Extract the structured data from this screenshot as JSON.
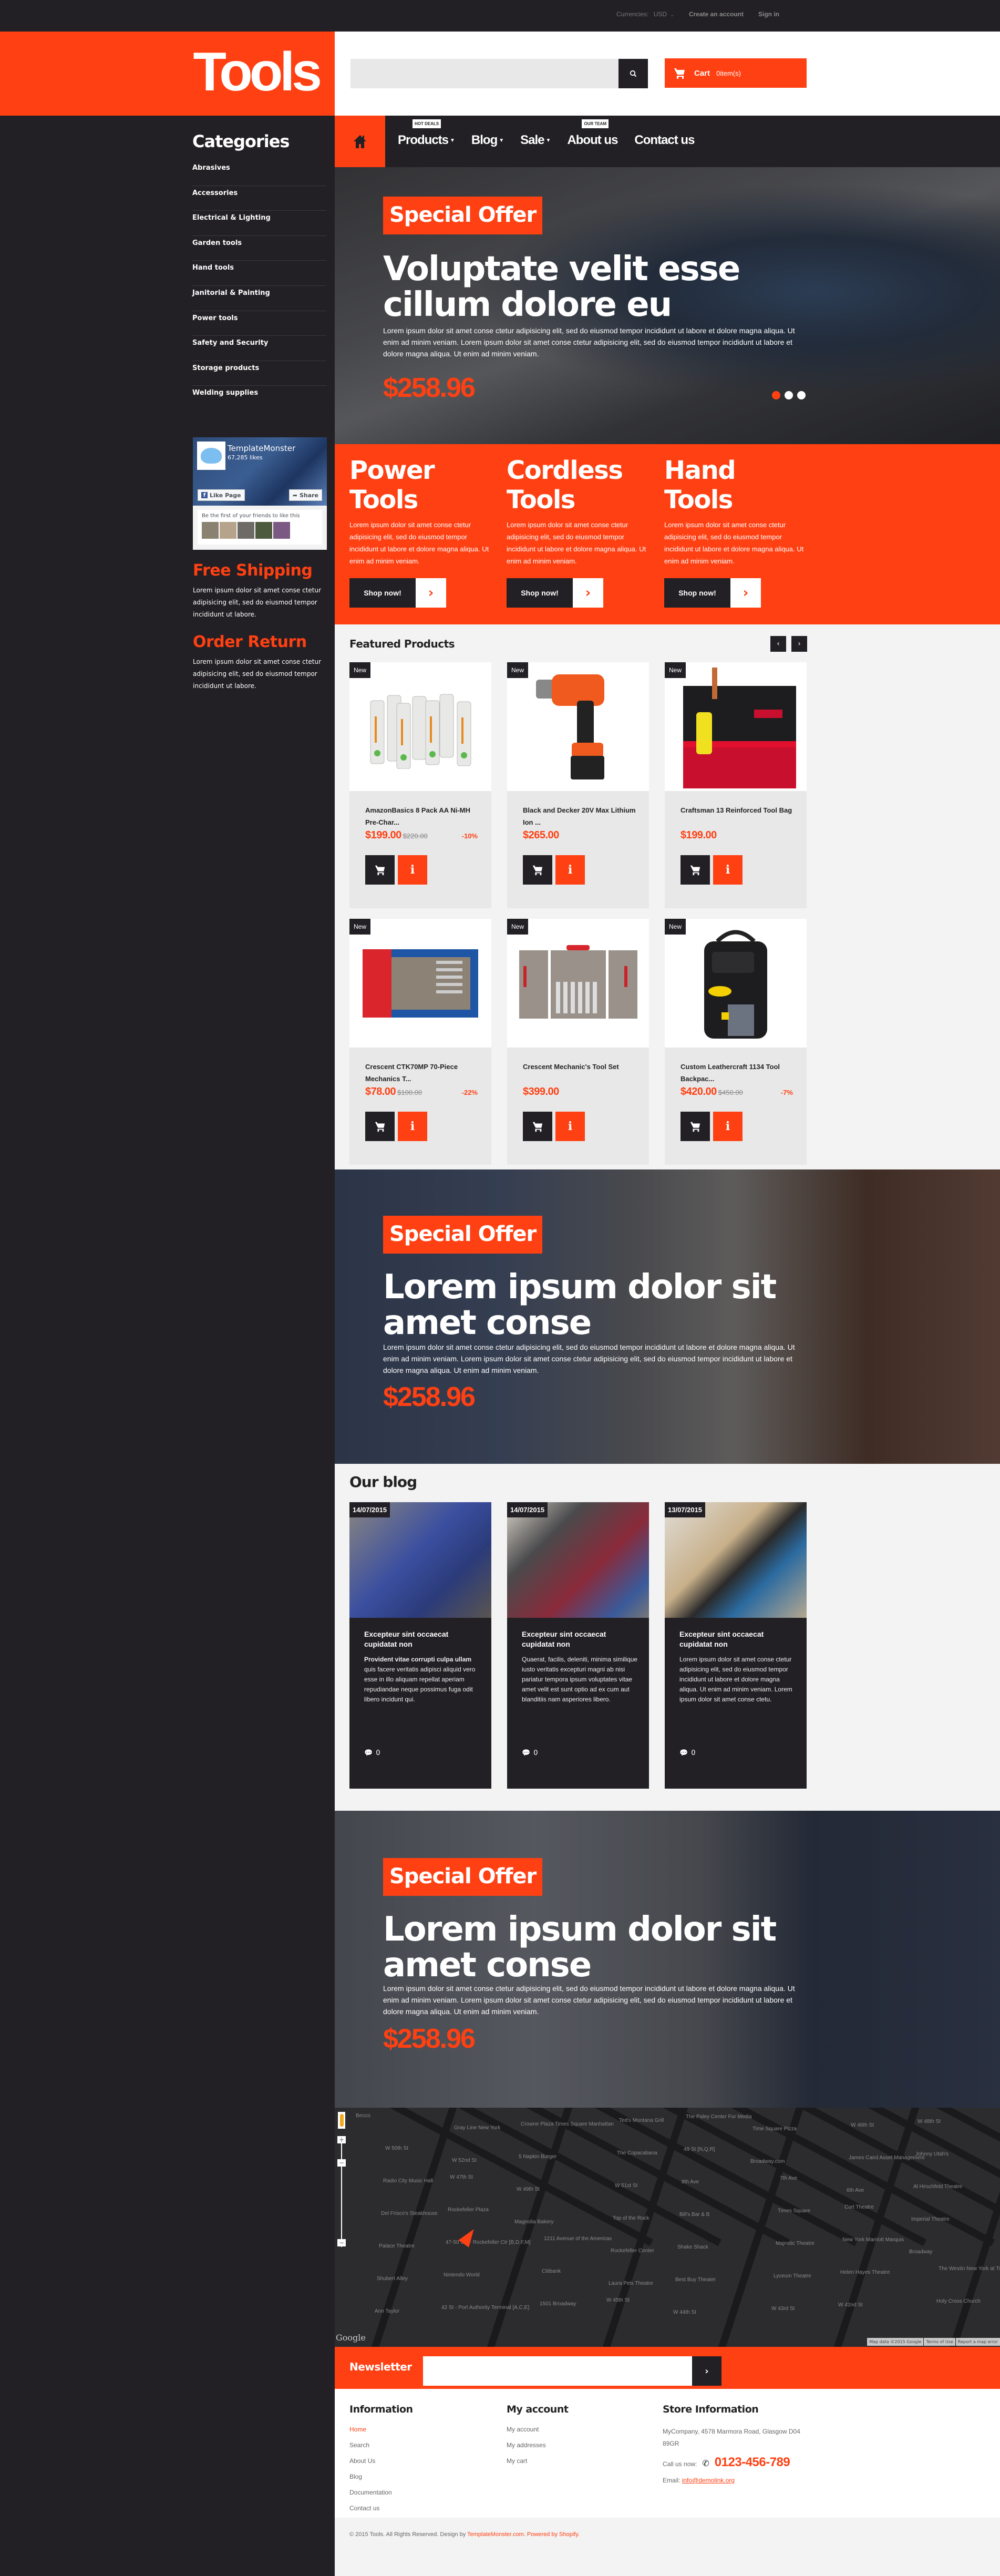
{
  "colors": {
    "accent": "#ff4013",
    "dark": "#222024",
    "light_bg": "#f3f3f3"
  },
  "topbar": {
    "currency_label": "Currencies:",
    "currency_value": "USD",
    "create_account": "Create an account",
    "sign_in": "Sign in"
  },
  "header": {
    "logo": "Tools",
    "search": {
      "placeholder": "",
      "value": "",
      "icon": "search-icon"
    },
    "cart": {
      "label": "Cart",
      "count": "0item(s)",
      "icon": "cart-icon"
    }
  },
  "nav": {
    "home_icon": "home-icon",
    "items": [
      {
        "label": "Products",
        "has_dropdown": true,
        "badge": "HOT DEALS"
      },
      {
        "label": "Blog",
        "has_dropdown": true,
        "badge": null
      },
      {
        "label": "Sale",
        "has_dropdown": true,
        "badge": null
      },
      {
        "label": "About us",
        "has_dropdown": false,
        "badge": "OUR TEAM"
      },
      {
        "label": "Contact us",
        "has_dropdown": false,
        "badge": null
      }
    ]
  },
  "sidebar": {
    "title": "Categories",
    "categories": [
      "Abrasives",
      "Accessories",
      "Electrical & Lighting",
      "Garden tools",
      "Hand tools",
      "Janitorial & Painting",
      "Power tools",
      "Safety and Security",
      "Storage products",
      "Welding supplies"
    ],
    "facebook": {
      "page_name": "TemplateMonster",
      "likes": "67,285 likes",
      "like_button": "Like Page",
      "share_button": "Share",
      "friends_text": "Be the first of your friends to like this"
    },
    "promos": [
      {
        "title": "Free Shipping",
        "text": "Lorem ipsum dolor sit amet conse ctetur adipisicing elit, sed do eiusmod tempor incididunt ut labore."
      },
      {
        "title": "Order Return",
        "text": "Lorem ipsum dolor sit amet conse ctetur adipisicing elit, sed do eiusmod tempor incididunt ut labore."
      }
    ]
  },
  "hero_slider": {
    "badge": "Special Offer",
    "headline_line1": "Voluptate velit esse",
    "headline_line2": "cillum dolore eu",
    "body": "Lorem ipsum dolor sit amet conse ctetur adipisicing elit, sed do eiusmod tempor incididunt ut labore et dolore magna aliqua. Ut enim ad minim veniam. Lorem ipsum dolor sit amet conse ctetur adipisicing elit, sed do eiusmod tempor incididunt ut labore et dolore magna aliqua. Ut enim ad minim veniam.",
    "price": "$258.96",
    "slide_count": 3,
    "active_slide": 1
  },
  "category_promos": [
    {
      "title_line1": "Power",
      "title_line2": "Tools",
      "text": "Lorem ipsum dolor sit amet conse ctetur adipisicing elit, sed do eiusmod tempor incididunt ut labore et dolore magna aliqua. Ut enim ad minim veniam.",
      "button": "Shop now!"
    },
    {
      "title_line1": "Cordless",
      "title_line2": "Tools",
      "text": "Lorem ipsum dolor sit amet conse ctetur adipisicing elit, sed do eiusmod tempor incididunt ut labore et dolore magna aliqua. Ut enim ad minim veniam.",
      "button": "Shop now!"
    },
    {
      "title_line1": "Hand",
      "title_line2": "Tools",
      "text": "Lorem ipsum dolor sit amet conse ctetur adipisicing elit, sed do eiusmod tempor incididunt ut labore et dolore magna aliqua. Ut enim ad minim veniam.",
      "button": "Shop now!"
    }
  ],
  "featured": {
    "title": "Featured Products",
    "prev": "‹",
    "next": "›",
    "products": [
      {
        "badge": "New",
        "name": "AmazonBasics 8 Pack AA Ni-MH Pre-Char...",
        "price": "$199.00",
        "old_price": "$220.00",
        "discount": "-10%",
        "image": "batteries"
      },
      {
        "badge": "New",
        "name": "Black and Decker 20V Max Lithium Ion ...",
        "price": "$265.00",
        "old_price": null,
        "discount": null,
        "image": "drill"
      },
      {
        "badge": "New",
        "name": "Craftsman 13 Reinforced Tool Bag",
        "price": "$199.00",
        "old_price": null,
        "discount": null,
        "image": "tool-bag"
      },
      {
        "badge": "New",
        "name": "Crescent CTK70MP 70-Piece Mechanics T...",
        "price": "$78.00",
        "old_price": "$100.00",
        "discount": "-22%",
        "image": "tool-set-box"
      },
      {
        "badge": "New",
        "name": "Crescent Mechanic's Tool Set",
        "price": "$399.00",
        "old_price": null,
        "discount": null,
        "image": "tool-case"
      },
      {
        "badge": "New",
        "name": "Custom Leathercraft 1134 Tool Backpac...",
        "price": "$420.00",
        "old_price": "$450.00",
        "discount": "-7%",
        "image": "backpack"
      }
    ]
  },
  "banner2": {
    "badge": "Special Offer",
    "headline_line1": "Lorem ipsum dolor sit",
    "headline_line2": "amet conse",
    "body": "Lorem ipsum dolor sit amet conse ctetur adipisicing elit, sed do eiusmod tempor incididunt ut labore et dolore magna aliqua. Ut enim ad minim veniam. Lorem ipsum dolor sit amet conse ctetur adipisicing elit, sed do eiusmod tempor incididunt ut labore et dolore magna aliqua. Ut enim ad minim veniam.",
    "price": "$258.96"
  },
  "blog": {
    "title": "Our blog",
    "posts": [
      {
        "date": "14/07/2015",
        "title": "Excepteur sint occaecat cupidatat non",
        "text_bold": "Provident vitae corrupti culpa ullam",
        "text": " quis facere veritatis adipisci aliquid vero esse in illo aliquam repellat aperiam repudiandae neque possimus fuga odit libero incidunt qui.",
        "comments": "0"
      },
      {
        "date": "14/07/2015",
        "title": "Excepteur sint occaecat cupidatat non",
        "text_bold": "",
        "text": "Quaerat, facilis, deleniti, minima similique iusto veritatis excepturi magni ab nisi pariatur tempora ipsum voluptates vitae amet velit est sunt optio ad ex cum aut blanditiis nam asperiores libero.",
        "comments": "0"
      },
      {
        "date": "13/07/2015",
        "title": "Excepteur sint occaecat cupidatat non",
        "text_bold": "",
        "text": "Lorem ipsum dolor sit amet conse ctetur adipisicing elit, sed do eiusmod tempor incididunt ut labore et dolore magna aliqua. Ut enim ad minim veniam. Lorem ipsum dolor sit amet conse ctetu.",
        "comments": "0"
      }
    ]
  },
  "banner3": {
    "badge": "Special Offer",
    "headline_line1": "Lorem ipsum dolor sit",
    "headline_line2": "amet conse",
    "body": "Lorem ipsum dolor sit amet conse ctetur adipisicing elit, sed do eiusmod tempor incididunt ut labore et dolore magna aliqua. Ut enim ad minim veniam. Lorem ipsum dolor sit amet conse ctetur adipisicing elit, sed do eiusmod tempor incididunt ut labore et dolore magna aliqua. Ut enim ad minim veniam.",
    "price": "$258.96"
  },
  "map": {
    "labels": [
      "Becco",
      "Gray Line New York",
      "Crowne Plaza Times Square Manhattan",
      "Ted's Montana Grill",
      "The Paley Center For Media",
      "Time Square Pizza",
      "W 46th St",
      "W 48th St",
      "W 50th St",
      "W 52nd St",
      "5 Napkin Burger",
      "The Copacabana",
      "49 St [N,Q,R]",
      "Broadway.com",
      "James Caird Asset Management",
      "Johnny Utah's",
      "Radio City Music Hall",
      "W 47th St",
      "W 49th St",
      "W 51st St",
      "8th Ave",
      "7th Ave",
      "6th Ave",
      "Al Hirschfeld Theatre",
      "Del Frisco's Steakhouse",
      "Rockefeller Plaza",
      "Magnolia Bakery",
      "Top of the Rock",
      "Bill's Bar & B",
      "Times Square",
      "Cort Theatre",
      "Imperial Theatre",
      "Palace Theatre",
      "47-50 Sts - Rockefeller Ctr [B,D,F,M]",
      "1211 Avenue of the Americas",
      "Rockefeller Center",
      "Shake Shack",
      "Majestic Theatre",
      "New York Marriott Marquis",
      "Broadway",
      "Shubert Alley",
      "Nintendo World",
      "Citibank",
      "Laura Pels Theatre",
      "Best Buy Theater",
      "Lyceum Theatre",
      "Helen Hayes Theatre",
      "The Westin New York at Times Square",
      "Ann Taylor",
      "42 St - Port Authority Terminal [A,C,E]",
      "1501 Broadway",
      "W 45th St",
      "W 44th St",
      "W 43rd St",
      "W 42nd St",
      "Holy Cross Church"
    ],
    "google_logo": "Google",
    "attribution": [
      "Map data ©2015 Google",
      "Terms of Use",
      "Report a map error"
    ]
  },
  "newsletter": {
    "label": "Newsletter",
    "placeholder": "",
    "submit": "›"
  },
  "footer": {
    "information": {
      "title": "Information",
      "links": [
        {
          "label": "Home",
          "active": true
        },
        {
          "label": "Search",
          "active": false
        },
        {
          "label": "About Us",
          "active": false
        },
        {
          "label": "Blog",
          "active": false
        },
        {
          "label": "Documentation",
          "active": false
        },
        {
          "label": "Contact us",
          "active": false
        }
      ]
    },
    "account": {
      "title": "My account",
      "links": [
        "My account",
        "My addresses",
        "My cart"
      ]
    },
    "store": {
      "title": "Store Information",
      "address": "MyCompany, 4578 Marmora Road, Glasgow D04 89GR",
      "call_label": "Call us now:",
      "phone": "0123-456-789",
      "email_label": "Email:",
      "email": "info@demolink.org"
    },
    "copyright_prefix": "© 2015 Tools. All Rights Reserved. Design by ",
    "copyright_link1": "TemplateMonster.com",
    "copyright_sep": ". ",
    "copyright_link2": "Powered by Shopify",
    "copyright_suffix": "."
  }
}
